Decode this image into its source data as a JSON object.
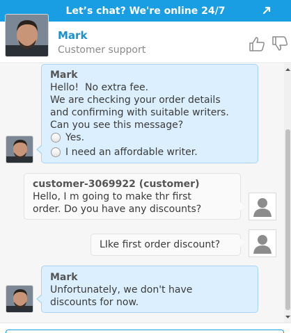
{
  "banner": {
    "title": "Let’s chat? We're online 24/7",
    "expand_icon": "expand-arrow-icon"
  },
  "agent": {
    "name": "Mark",
    "role": "Customer support",
    "rate_up_icon": "thumbs-up-icon",
    "rate_down_icon": "thumbs-down-icon"
  },
  "colors": {
    "accent": "#1a9ee3",
    "agent_bubble": "#dcefff",
    "user_bubble": "#fafafa"
  },
  "messages": [
    {
      "from": "agent",
      "sender": "Mark",
      "lines": [
        "Hello!  No extra fee.",
        "We are checking your order details",
        "and confirming with suitable writers.",
        "Can you see this message?"
      ],
      "options": [
        "Yes.",
        "I need an affordable writer."
      ]
    },
    {
      "from": "user",
      "sender": "customer-3069922 (customer)",
      "lines": [
        "Hello, I m going to make thr first",
        "order. Do you have any discounts?"
      ]
    },
    {
      "from": "user",
      "lines": [
        "LIke first order discount?"
      ]
    },
    {
      "from": "agent",
      "sender": "Mark",
      "lines": [
        "Unfortunately, we don't have",
        "discounts for now."
      ]
    }
  ]
}
